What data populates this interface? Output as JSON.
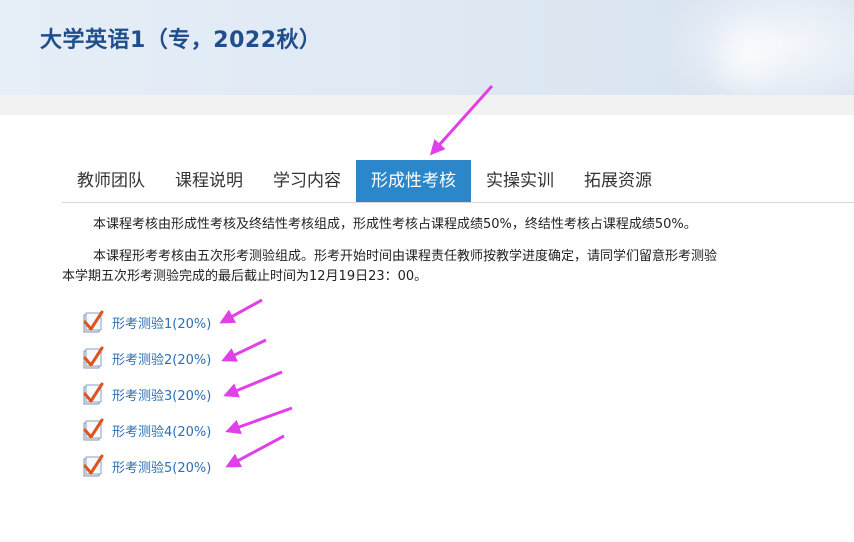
{
  "header": {
    "course_title": "大学英语1（专，2022秋）"
  },
  "tabs": [
    {
      "label": "教师团队"
    },
    {
      "label": "课程说明"
    },
    {
      "label": "学习内容"
    },
    {
      "label": "形成性考核",
      "active": true
    },
    {
      "label": "实操实训"
    },
    {
      "label": "拓展资源"
    }
  ],
  "content": {
    "para1": "本课程考核由形成性考核及终结性考核组成，形成性考核占课程成绩50%，终结性考核占课程成绩50%。",
    "para2_line1": "本课程形考考核由五次形考测验组成。形考开始时间由课程责任教师按教学进度确定，请同学们留意形考测验",
    "para2_line2": "本学期五次形考测验完成的最后截止时间为12月19日23：00。"
  },
  "quizzes": [
    {
      "label": "形考测验1(20%)"
    },
    {
      "label": "形考测验2(20%)"
    },
    {
      "label": "形考测验3(20%)"
    },
    {
      "label": "形考测验4(20%)"
    },
    {
      "label": "形考测验5(20%)"
    }
  ],
  "colors": {
    "accent": "#2b87c9",
    "title": "#1f4e8c",
    "link": "#2b6fb5",
    "annotation_arrow": "#e040e8",
    "check": "#e0531e"
  },
  "icons": {
    "quiz_icon": "quiz-checkbox-icon",
    "annotation": "arrow-annotation-icon"
  }
}
